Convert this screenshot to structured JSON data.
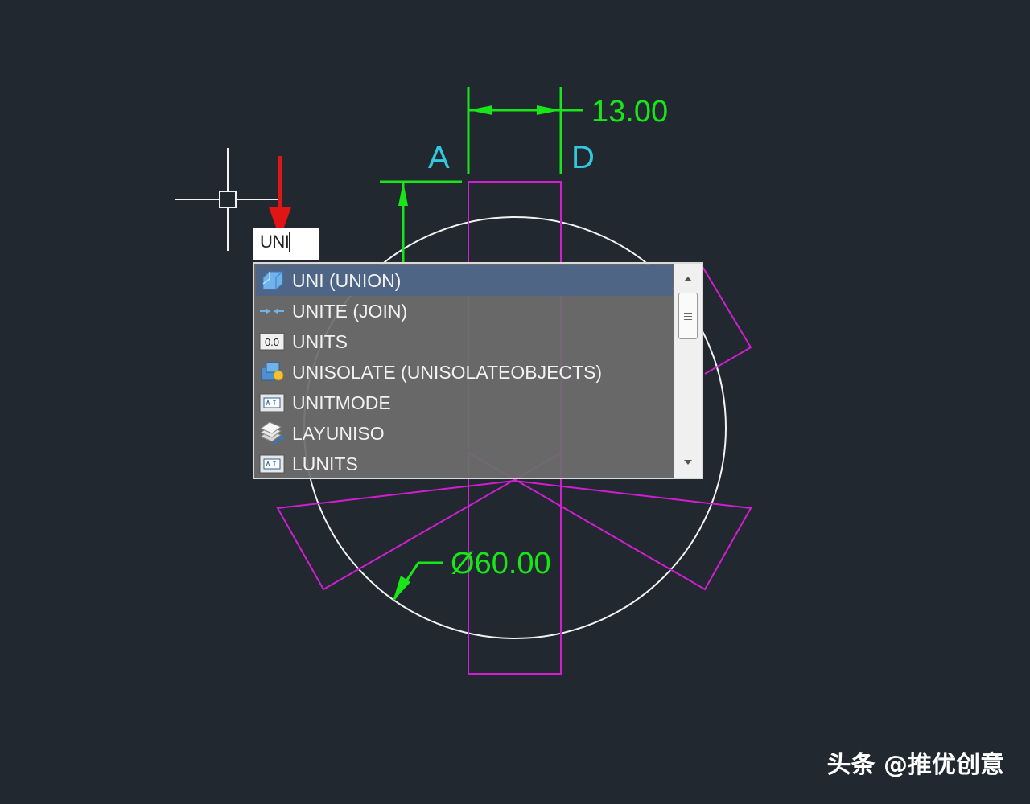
{
  "command_input": {
    "value": "UNI"
  },
  "autocomplete": {
    "items": [
      {
        "label": "UNI (UNION)",
        "icon": "union-icon",
        "selected": true
      },
      {
        "label": "UNITE (JOIN)",
        "icon": "join-icon",
        "selected": false
      },
      {
        "label": "UNITS",
        "icon": "units-icon",
        "selected": false
      },
      {
        "label": "UNISOLATE (UNISOLATEOBJECTS)",
        "icon": "unisolate-icon",
        "selected": false
      },
      {
        "label": "UNITMODE",
        "icon": "system-variable-icon",
        "selected": false
      },
      {
        "label": "LAYUNISO",
        "icon": "layers-icon",
        "selected": false
      },
      {
        "label": "LUNITS",
        "icon": "system-variable-icon",
        "selected": false
      }
    ],
    "units_icon_text": "0.0"
  },
  "drawing": {
    "dim_horizontal": "13.00",
    "dim_diameter": "Ø60.00",
    "label_a": "A",
    "label_d": "D"
  },
  "colors": {
    "background": "#212830",
    "dimension": "#19e619",
    "magenta_geometry": "#d11ed1",
    "circle": "#ffffff",
    "point_labels": "#33c7e0",
    "arrow_red": "#e01515",
    "selected_row": "#4f6585"
  },
  "watermark": {
    "source": "头条",
    "author": "@推优创意"
  }
}
